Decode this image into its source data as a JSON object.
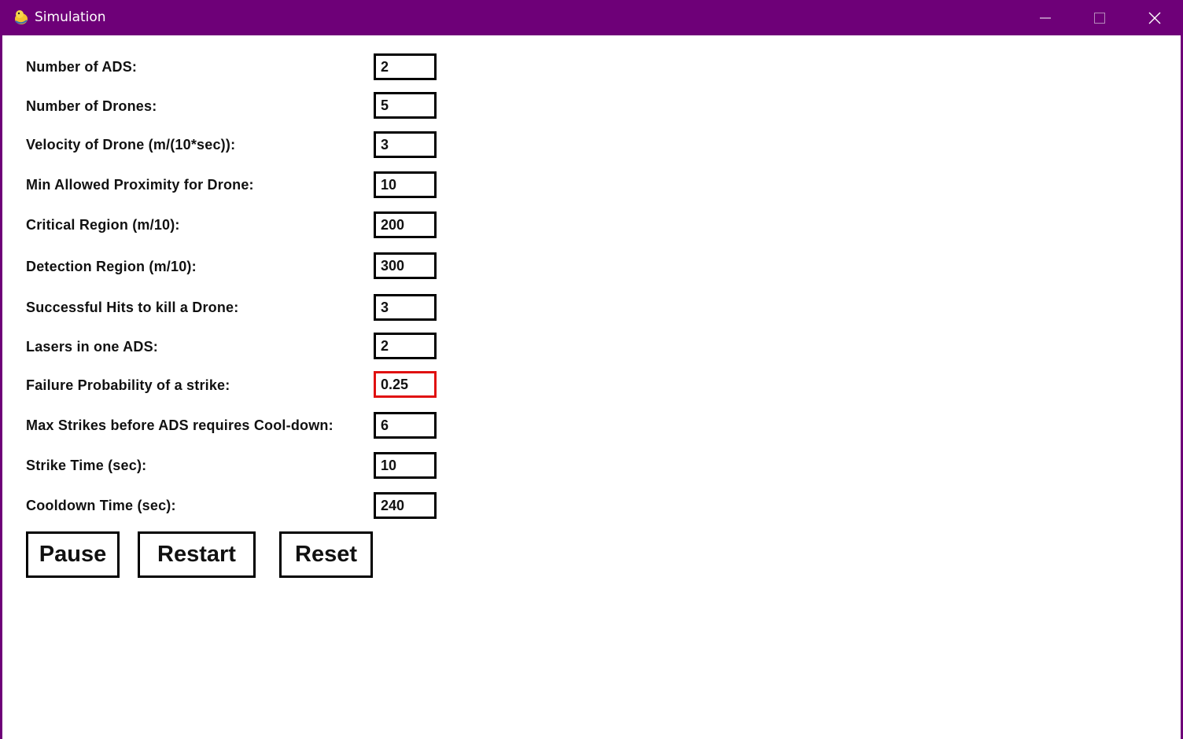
{
  "window": {
    "title": "Simulation",
    "icon": "pygame-snake-icon",
    "controls": [
      "minimize-icon",
      "maximize-icon",
      "close-icon"
    ],
    "accent_color": "#6e0078"
  },
  "fields": [
    {
      "label": "Number of ADS:",
      "value": "2"
    },
    {
      "label": "Number of Drones:",
      "value": "5"
    },
    {
      "label": "Velocity of Drone (m/(10*sec)):",
      "value": "3"
    },
    {
      "label": "Min Allowed Proximity for Drone:",
      "value": "10"
    },
    {
      "label": "Critical Region (m/10):",
      "value": "200"
    },
    {
      "label": "Detection Region (m/10):",
      "value": "300"
    },
    {
      "label": "Successful Hits to kill a Drone:",
      "value": "3"
    },
    {
      "label": "Lasers in one ADS:",
      "value": "2"
    },
    {
      "label": "Failure Probability of a strike:",
      "value": "0.25",
      "active": true
    },
    {
      "label": "Max Strikes before ADS requires Cool-down:",
      "value": "6"
    },
    {
      "label": "Strike Time (sec):",
      "value": "10"
    },
    {
      "label": "Cooldown Time (sec):",
      "value": "240"
    }
  ],
  "active_border_color": "#e01010",
  "buttons": {
    "pause": "Pause",
    "restart": "Restart",
    "reset": "Reset"
  }
}
